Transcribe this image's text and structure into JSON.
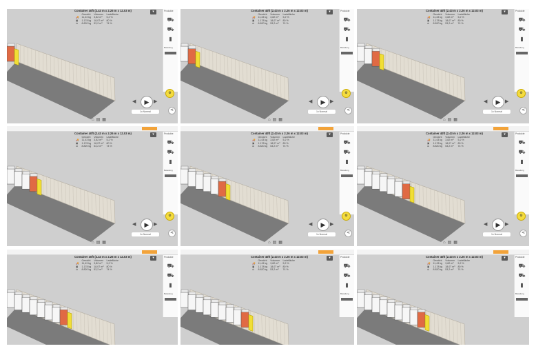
{
  "title": "Container 40ft (2.43 m x 2.26 m x 12.03 m)",
  "table": {
    "headers": [
      "Gewicht",
      "Volumen",
      "Ladefläche"
    ],
    "rows": [
      {
        "icon": "truck",
        "values": [
          "11,43 kg",
          "3,82 m³",
          "5,2 %"
        ]
      },
      {
        "icon": "box",
        "values": [
          "1.178 kg",
          "18,07 m³",
          "80 %"
        ]
      },
      {
        "icon": "weight",
        "values": [
          "8.820 kg",
          "53,2 m³",
          "74 %"
        ]
      }
    ]
  },
  "panel": {
    "header": "Produkte",
    "footer": "Beladung"
  },
  "speed": "1x Normal",
  "colors": {
    "cargo_white": "#f6f6f6",
    "cargo_red": "#e06a44",
    "cargo_yellow": "#f1de35",
    "floor": "#7b7b7b",
    "wall": "#e2ddd2",
    "accent_play": "#f4dc3e"
  },
  "frames": [
    {
      "load": 0.1
    },
    {
      "load": 0.14
    },
    {
      "load": 0.18
    },
    {
      "load": 0.3
    },
    {
      "load": 0.38
    },
    {
      "load": 0.5
    },
    {
      "load": 0.55
    },
    {
      "load": 0.6
    },
    {
      "load": 0.65
    }
  ]
}
